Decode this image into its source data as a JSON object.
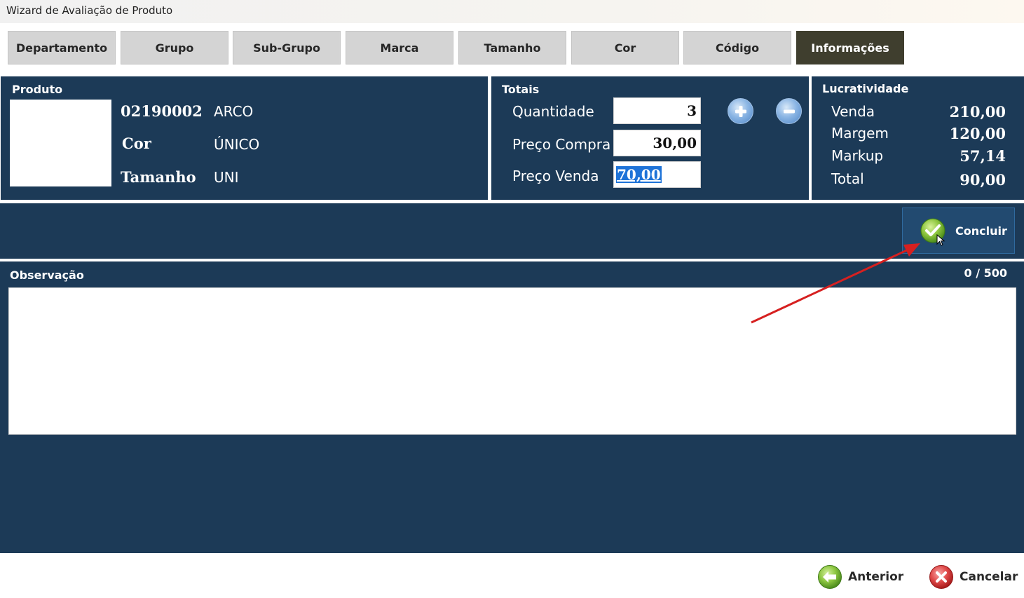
{
  "window": {
    "title": "Wizard de Avaliação de Produto"
  },
  "tabs": [
    {
      "label": "Departamento"
    },
    {
      "label": "Grupo"
    },
    {
      "label": "Sub-Grupo"
    },
    {
      "label": "Marca"
    },
    {
      "label": "Tamanho"
    },
    {
      "label": "Cor"
    },
    {
      "label": "Código"
    },
    {
      "label": "Informações",
      "active": true
    }
  ],
  "produto": {
    "title": "Produto",
    "code": "02190002",
    "name": "ARCO",
    "cor_label": "Cor",
    "cor_value": "ÚNICO",
    "tamanho_label": "Tamanho",
    "tamanho_value": "UNI"
  },
  "totais": {
    "title": "Totais",
    "quantidade_label": "Quantidade",
    "quantidade_value": "3",
    "preco_compra_label": "Preço Compra",
    "preco_compra_value": "30,00",
    "preco_venda_label": "Preço Venda",
    "preco_venda_value": "70,00",
    "plus_icon": "plus-icon",
    "minus_icon": "minus-icon"
  },
  "lucratividade": {
    "title": "Lucratividade",
    "venda_label": "Venda",
    "venda_value": "210,00",
    "margem_label": "Margem",
    "margem_value": "120,00",
    "markup_label": "Markup",
    "markup_value": "57,14",
    "total_label": "Total",
    "total_value": "90,00"
  },
  "actions": {
    "concluir_label": "Concluir"
  },
  "observacao": {
    "title": "Observação",
    "counter": "0 / 500",
    "value": ""
  },
  "footer": {
    "anterior_label": "Anterior",
    "cancelar_label": "Cancelar"
  },
  "colors": {
    "panel": "#1c3a57",
    "active_tab": "#3f3e2e",
    "tab": "#d4d4d4",
    "annotation_arrow": "#d62020"
  }
}
